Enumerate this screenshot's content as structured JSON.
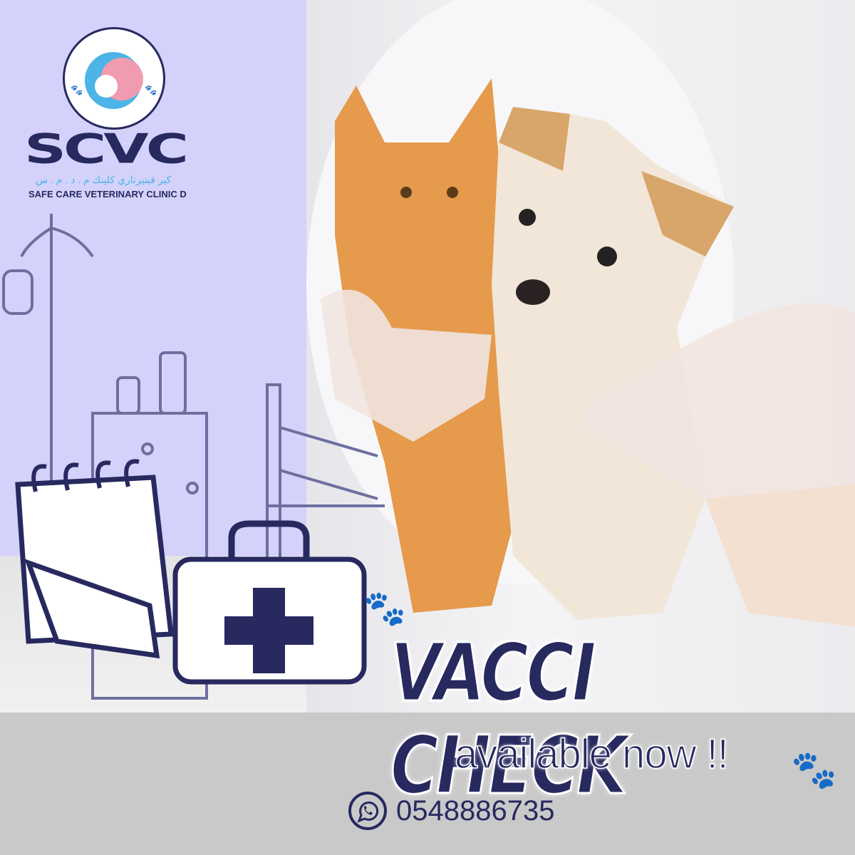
{
  "brand": {
    "logo_text": "SCVC",
    "arabic_name": "كير فيتيرناري كلينك م . د . م . س",
    "english_name": "SAFE CARE VETERINARY CLINIC D"
  },
  "headline": "VACCI CHECK",
  "subheadline": "available now !!",
  "contact": {
    "icon": "whatsapp-icon",
    "phone": "0548886735"
  },
  "colors": {
    "navy": "#27295f",
    "lavender": "#d4d2fb",
    "band": "#c9c9c9",
    "accent_blue": "#4cb4e6",
    "accent_pink": "#f19bb0"
  }
}
